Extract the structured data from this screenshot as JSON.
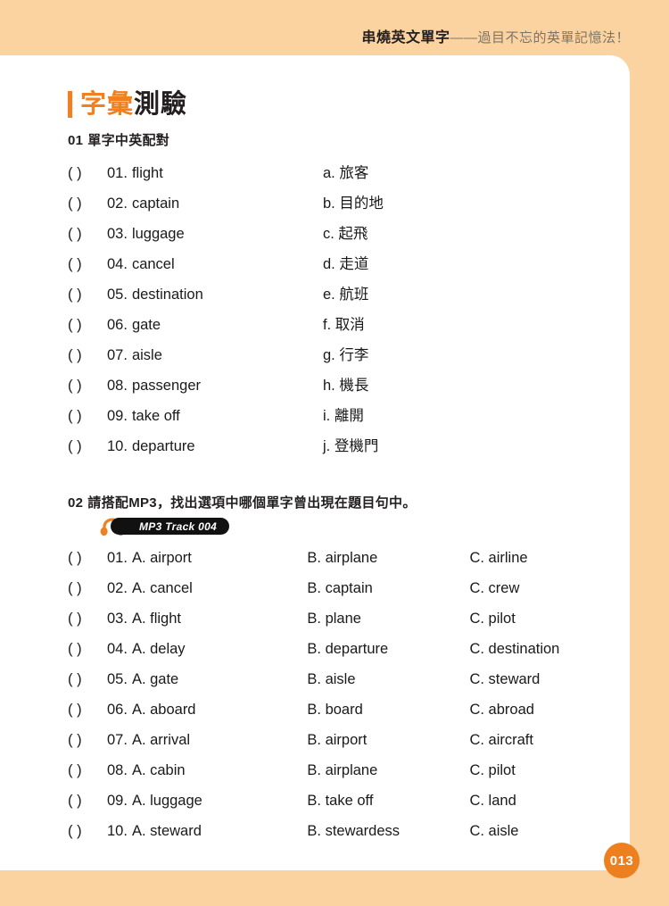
{
  "header": {
    "title_bold": "串燒英文單字",
    "title_light": "——過目不忘的英單記憶法！"
  },
  "title": {
    "orange_part": "字彙",
    "black_part": "測驗"
  },
  "sections": [
    {
      "number": "01",
      "heading": "單字中英配對",
      "type": "matching",
      "items": [
        {
          "paren": "(     )",
          "num": "01.",
          "word": "flight"
        },
        {
          "paren": "(     )",
          "num": "02.",
          "word": "captain"
        },
        {
          "paren": "(     )",
          "num": "03.",
          "word": "luggage"
        },
        {
          "paren": "(     )",
          "num": "04.",
          "word": "cancel"
        },
        {
          "paren": "(     )",
          "num": "05.",
          "word": "destination"
        },
        {
          "paren": "(     )",
          "num": "06.",
          "word": "gate"
        },
        {
          "paren": "(     )",
          "num": "07.",
          "word": "aisle"
        },
        {
          "paren": "(     )",
          "num": "08.",
          "word": "passenger"
        },
        {
          "paren": "(     )",
          "num": "09.",
          "word": "take off"
        },
        {
          "paren": "(     )",
          "num": "10.",
          "word": "departure"
        }
      ],
      "choices": [
        "a. 旅客",
        "b. 目的地",
        "c. 起飛",
        "d. 走道",
        "e. 航班",
        "f. 取消",
        "g. 行李",
        "h. 機長",
        "i. 離開",
        "j. 登機門"
      ]
    },
    {
      "number": "02",
      "heading": "請搭配MP3，找出選項中哪個單字曾出現在題目句中。",
      "type": "multiple-choice",
      "mp3_badge": "MP3 Track 004",
      "items": [
        {
          "paren": "(     )",
          "num": "01.",
          "a": "A. airport",
          "b": "B. airplane",
          "c": "C. airline"
        },
        {
          "paren": "(     )",
          "num": "02.",
          "a": "A. cancel",
          "b": "B. captain",
          "c": "C. crew"
        },
        {
          "paren": "(     )",
          "num": "03.",
          "a": "A. flight",
          "b": "B. plane",
          "c": "C. pilot"
        },
        {
          "paren": "(     )",
          "num": "04.",
          "a": "A. delay",
          "b": "B. departure",
          "c": "C. destination"
        },
        {
          "paren": "(     )",
          "num": "05.",
          "a": "A. gate",
          "b": "B. aisle",
          "c": "C. steward"
        },
        {
          "paren": "(     )",
          "num": "06.",
          "a": "A. aboard",
          "b": "B. board",
          "c": "C. abroad"
        },
        {
          "paren": "(     )",
          "num": "07.",
          "a": "A. arrival",
          "b": "B. airport",
          "c": "C. aircraft"
        },
        {
          "paren": "(     )",
          "num": "08.",
          "a": "A. cabin",
          "b": "B. airplane",
          "c": "C. pilot"
        },
        {
          "paren": "(     )",
          "num": "09.",
          "a": "A. luggage",
          "b": "B. take off",
          "c": "C. land"
        },
        {
          "paren": "(     )",
          "num": "10.",
          "a": "A. steward",
          "b": "B. stewardess",
          "c": "C. aisle"
        }
      ]
    }
  ],
  "page_number": "013",
  "colors": {
    "accent_orange": "#f08020",
    "page_band": "#fad3a0",
    "badge_black": "#111111"
  }
}
